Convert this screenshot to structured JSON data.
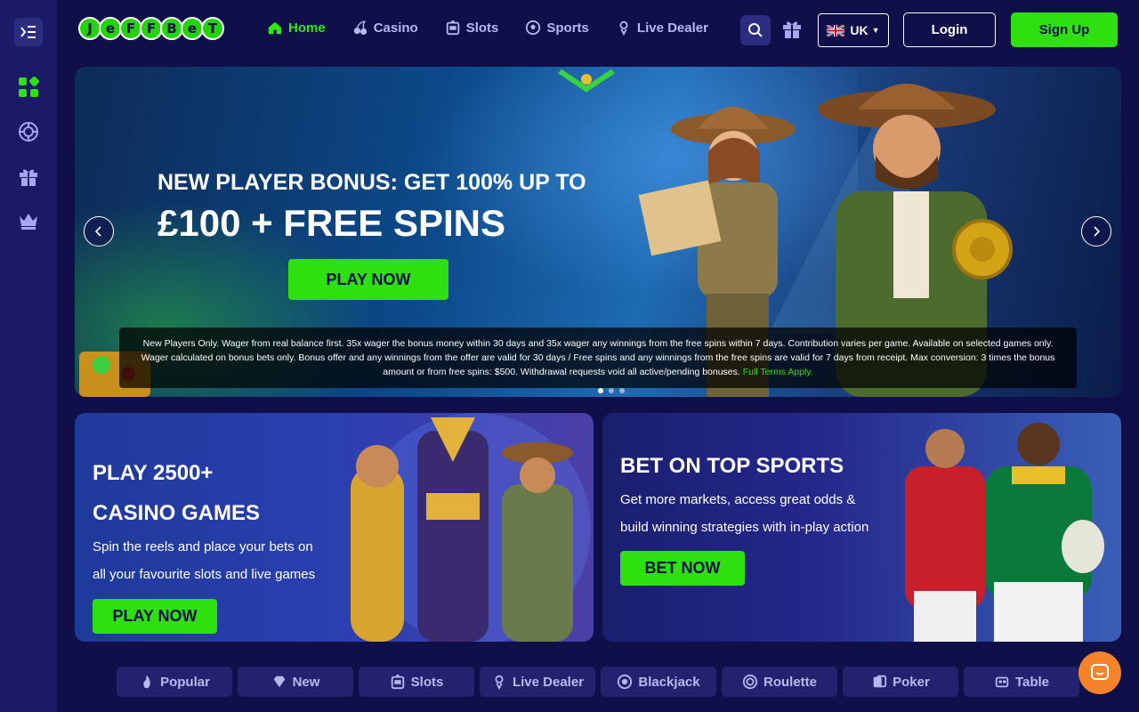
{
  "brand": {
    "logo_letters": [
      "J",
      "e",
      "F",
      "F",
      "B",
      "e",
      "T"
    ],
    "accent": "#2ee00f"
  },
  "nav": [
    {
      "label": "Home",
      "icon": "home-icon",
      "active": true
    },
    {
      "label": "Casino",
      "icon": "cherries-icon"
    },
    {
      "label": "Slots",
      "icon": "slot-machine-icon"
    },
    {
      "label": "Sports",
      "icon": "soccer-ball-icon"
    },
    {
      "label": "Live Dealer",
      "icon": "dealer-icon"
    }
  ],
  "header": {
    "lang": "UK",
    "login": "Login",
    "signup": "Sign Up"
  },
  "sidebar": {
    "items": [
      "toggle-menu-icon",
      "grid-icon",
      "chip-icon",
      "gift-icon",
      "crown-icon"
    ]
  },
  "hero": {
    "title_line1": "NEW PLAYER BONUS: GET 100% UP TO",
    "title_line2": "£100 + FREE SPINS",
    "cta": "PLAY NOW",
    "terms": "New Players Only. Wager from real balance first. 35x wager the bonus money within 30 days and 35x wager any winnings from the free spins within 7 days. Contribution varies per game. Available on selected games only. Wager calculated on bonus bets only. Bonus offer and any winnings from the offer are valid for 30 days / Free spins and any winnings from the free spins are valid for 7 days from receipt. Max conversion: 3 times the bonus amount or from free spins: $500. Withdrawal requests void all active/pending bonuses.",
    "terms_link": "Full Terms Apply."
  },
  "cards": {
    "casino": {
      "title1": "PLAY 2500+",
      "title2": "CASINO GAMES",
      "text1": "Spin the reels and place your bets on",
      "text2": "all your favourite slots and live games",
      "cta": "PLAY NOW"
    },
    "sports": {
      "title": "BET ON TOP SPORTS",
      "text1": "Get more markets, access great odds &",
      "text2": "build winning strategies with in-play action",
      "cta": "BET NOW"
    }
  },
  "categories": [
    {
      "label": "Popular",
      "icon": "fire-icon"
    },
    {
      "label": "New",
      "icon": "diamond-icon"
    },
    {
      "label": "Slots",
      "icon": "slot-machine-icon"
    },
    {
      "label": "Live Dealer",
      "icon": "dealer-icon"
    },
    {
      "label": "Blackjack",
      "icon": "chip-icon"
    },
    {
      "label": "Roulette",
      "icon": "roulette-icon"
    },
    {
      "label": "Poker",
      "icon": "cards-icon"
    },
    {
      "label": "Table",
      "icon": "table-icon"
    }
  ]
}
